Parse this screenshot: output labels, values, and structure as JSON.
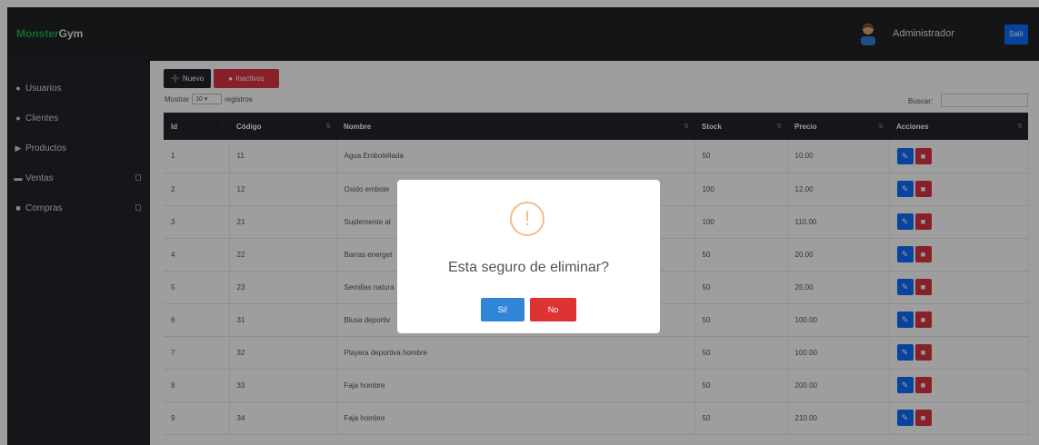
{
  "brand": {
    "part1": "Monster",
    "part2": "Gym"
  },
  "header": {
    "user": "Administrador",
    "logout_label": "Salir"
  },
  "sidebar": {
    "items": [
      {
        "label": "Usuarios",
        "icon": "user-icon"
      },
      {
        "label": "Clientes",
        "icon": "users-icon"
      },
      {
        "label": "Productos",
        "icon": "tag-icon"
      },
      {
        "label": "Ventas",
        "icon": "cart-icon"
      },
      {
        "label": "Compras",
        "icon": "bag-icon"
      }
    ]
  },
  "toolbar": {
    "new_label": "Nuevo",
    "inactive_label": "Inactivos"
  },
  "datatable": {
    "show_label": "Mostrar",
    "page_size": "10",
    "records_label": "registros",
    "search_label": "Buscar:"
  },
  "table": {
    "columns": [
      "Id",
      "Código",
      "Nombre",
      "Stock",
      "Precio",
      "Acciones"
    ],
    "rows": [
      [
        "1",
        "11",
        "Agua Embotellada",
        "50",
        "10.00"
      ],
      [
        "2",
        "12",
        "Oxido embote",
        "100",
        "12.00"
      ],
      [
        "3",
        "21",
        "Suplemente al",
        "100",
        "110.00"
      ],
      [
        "4",
        "22",
        "Barras energet",
        "50",
        "20.00"
      ],
      [
        "5",
        "23",
        "Semillas natura",
        "50",
        "25.00"
      ],
      [
        "6",
        "31",
        "Blusa deportiv",
        "50",
        "100.00"
      ],
      [
        "7",
        "32",
        "Playera deportiva hombre",
        "50",
        "100.00"
      ],
      [
        "8",
        "33",
        "Faja hombre",
        "50",
        "200.00"
      ],
      [
        "9",
        "34",
        "Faja hombre",
        "50",
        "210.00"
      ]
    ]
  },
  "modal": {
    "title": "Esta seguro de eliminar?",
    "confirm_label": "Si!",
    "cancel_label": "No"
  },
  "colors": {
    "accent": "#0d6efd",
    "danger": "#dc3545",
    "dark": "#212529",
    "brand_green": "#28a745"
  }
}
